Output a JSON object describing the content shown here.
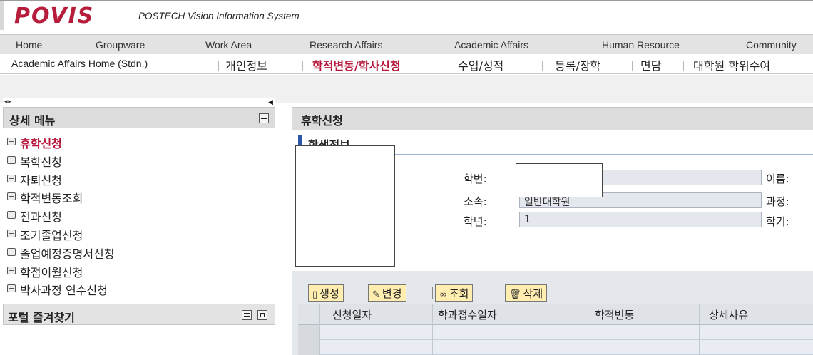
{
  "header": {
    "logo_text": "POVIS",
    "subtitle": "POSTECH Vision Information System"
  },
  "topnav": {
    "items": [
      "Home",
      "Groupware",
      "Work Area",
      "Research Affairs",
      "Academic Affairs",
      "Human Resource",
      "Community"
    ]
  },
  "subnav": {
    "home_label": "Academic Affairs Home (Stdn.)",
    "items": [
      "개인정보",
      "학적변동/학사신청",
      "수업/성적",
      "등록/장학",
      "면담",
      "대학원 학위수여"
    ],
    "active": "학적변동/학사신청"
  },
  "sidebar": {
    "scroll_controls": "◂ ▸",
    "title": "상세 메뉴",
    "items": [
      {
        "label": "휴학신청",
        "active": true
      },
      {
        "label": "복학신청"
      },
      {
        "label": "자퇴신청"
      },
      {
        "label": "학적변동조회"
      },
      {
        "label": "전과신청"
      },
      {
        "label": "조기졸업신청"
      },
      {
        "label": "졸업예정증명서신청"
      },
      {
        "label": "학점이월신청"
      },
      {
        "label": "박사과정 연수신청"
      }
    ],
    "favorites_title": "포털 즐겨찾기"
  },
  "content": {
    "page_title": "휴학신청",
    "section_title": "학생정보",
    "fields": {
      "student_id_label": "학번:",
      "affiliation_label": "소속:",
      "affiliation_value": "일반대학원",
      "year_label": "학년:",
      "year_value": "1",
      "name_label": "이름:",
      "program_label": "과정:",
      "semester_label": "학기:"
    }
  },
  "toolbar": {
    "create_label": "생성",
    "change_label": "변경",
    "search_label": "조회",
    "delete_label": "삭제"
  },
  "table": {
    "columns": [
      "신청일자",
      "학과접수일자",
      "학적변동",
      "상세사유"
    ]
  },
  "colors": {
    "brand": "#b51d3a",
    "section_marker": "#2c56a8",
    "toolbar_button": "#ffeeb0"
  }
}
